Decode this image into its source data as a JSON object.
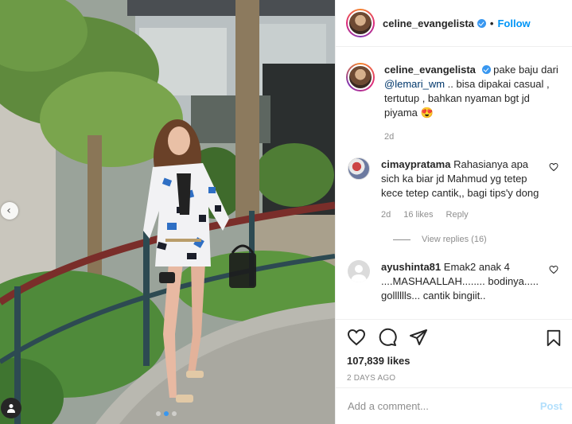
{
  "post": {
    "author": {
      "username": "celine_evangelista",
      "verified": true,
      "follow_label": "Follow",
      "separator": "•"
    },
    "photo": {
      "pagination": {
        "count": 3,
        "active": 1
      }
    },
    "caption": {
      "username": "celine_evangelista",
      "text_before_mention": "pake baju dari",
      "mention": "@lemari_wm",
      "text_after_mention": ".. bisa dipakai casual , tertutup , bahkan nyaman bgt jd piyama 😍",
      "age": "2d"
    },
    "comments": [
      {
        "username": "cimaypratama",
        "text": "Rahasianya apa sich ka biar jd Mahmud yg tetep kece tetep cantik,, bagi tips'y dong",
        "age": "2d",
        "likes": "16 likes",
        "reply_label": "Reply",
        "view_replies": "View replies (16)"
      },
      {
        "username": "ayushinta81",
        "text": "Emak2 anak 4 ....MASHAALLAH........ bodinya..... golllllls... cantik bingiit.."
      }
    ],
    "likes_count": "107,839 likes",
    "date_label": "2 DAYS AGO",
    "add_comment": {
      "placeholder": "Add a comment...",
      "post_label": "Post"
    },
    "colors": {
      "accent": "#0095f6",
      "verified": "#3897f0",
      "muted": "#8e8e8e",
      "post_disabled": "#b2dffc"
    }
  }
}
